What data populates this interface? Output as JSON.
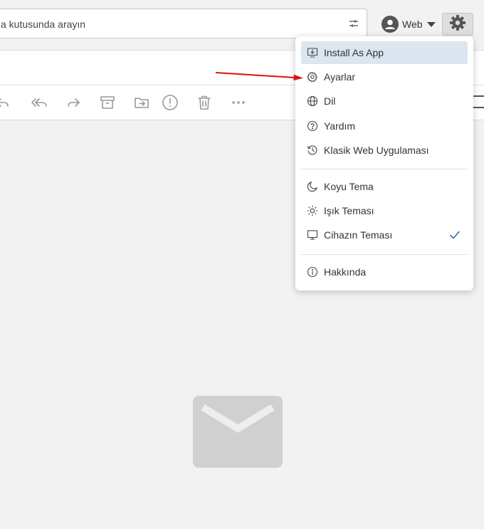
{
  "search": {
    "text": "a kutusunda arayın"
  },
  "account": {
    "label": "Web"
  },
  "menu": {
    "items": [
      {
        "label": "Install As App",
        "icon": "install-app-icon"
      },
      {
        "label": "Ayarlar",
        "icon": "gear-icon"
      },
      {
        "label": "Dil",
        "icon": "globe-icon"
      },
      {
        "label": "Yardım",
        "icon": "help-circle-icon"
      },
      {
        "label": "Klasik Web Uygulaması",
        "icon": "history-icon"
      },
      {
        "label": "Koyu Tema",
        "icon": "moon-icon"
      },
      {
        "label": "Işık Teması",
        "icon": "sun-icon"
      },
      {
        "label": "Cihazın Teması",
        "icon": "monitor-icon",
        "checked": true
      },
      {
        "label": "Hakkında",
        "icon": "info-icon"
      }
    ]
  },
  "colors": {
    "accent": "#2a6db0",
    "annotation_arrow": "#e01010",
    "active_item_bg": "#dbe6f0"
  }
}
